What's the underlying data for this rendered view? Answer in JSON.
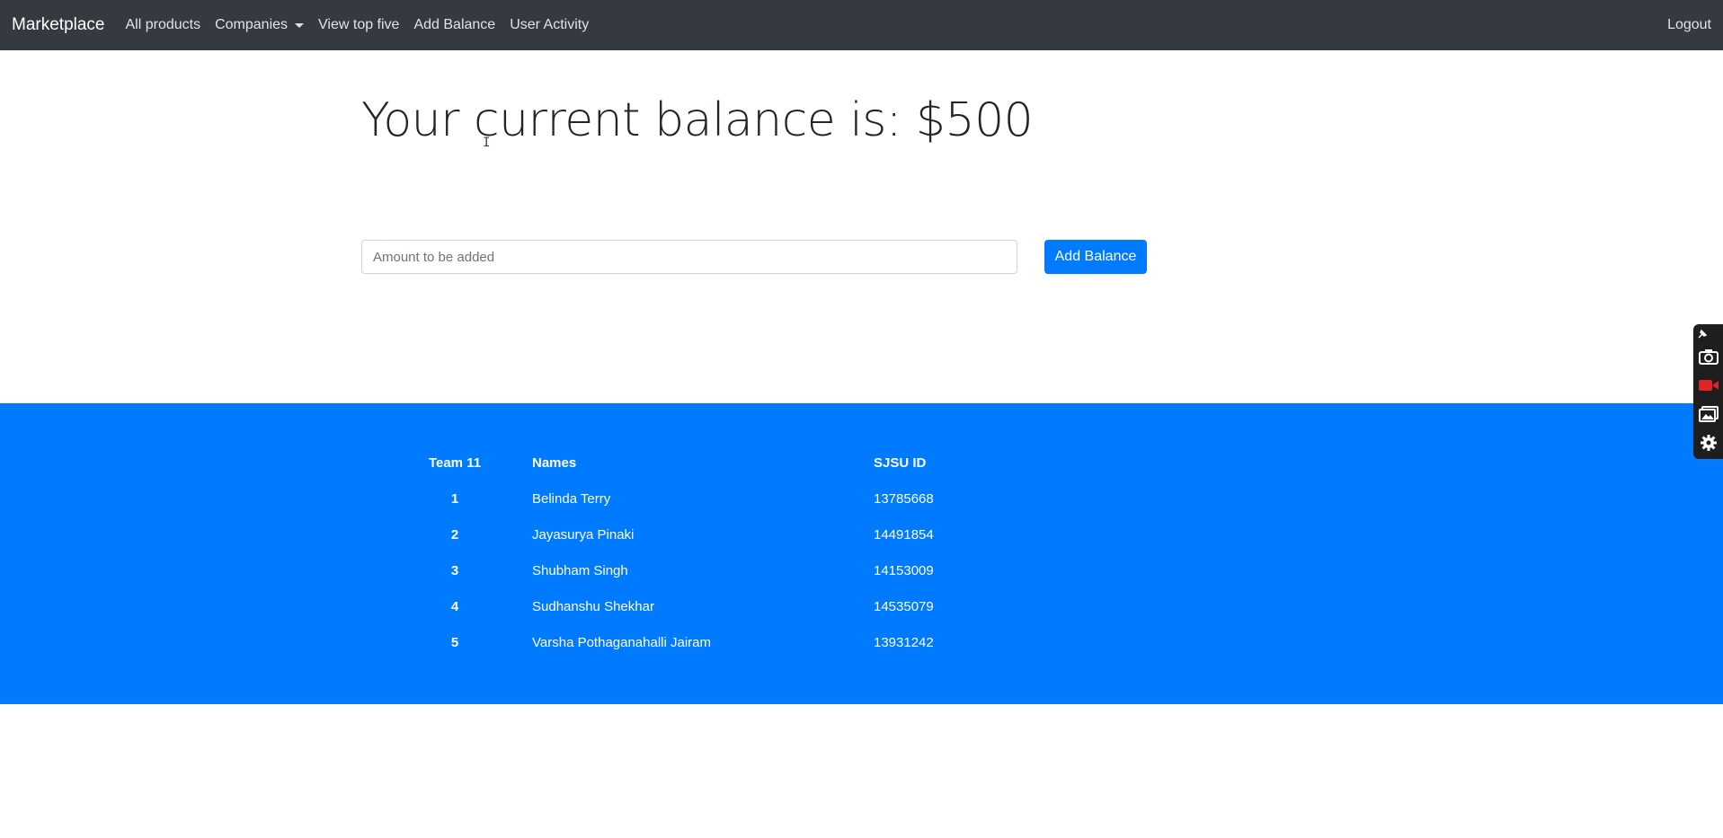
{
  "navbar": {
    "brand": "Marketplace",
    "links": [
      "All products",
      "Companies",
      "View top five",
      "Add Balance",
      "User Activity"
    ],
    "logout": "Logout"
  },
  "balance": {
    "title": "Your current balance is: $500"
  },
  "form": {
    "placeholder": "Amount to be added",
    "button_label": "Add Balance"
  },
  "team": {
    "headers": [
      "Team 11",
      "Names",
      "SJSU ID"
    ],
    "rows": [
      {
        "num": "1",
        "name": "Belinda Terry",
        "id": "13785668"
      },
      {
        "num": "2",
        "name": "Jayasurya Pinaki",
        "id": "14491854"
      },
      {
        "num": "3",
        "name": "Shubham Singh",
        "id": "14153009"
      },
      {
        "num": "4",
        "name": "Sudhanshu Shekhar",
        "id": "14535079"
      },
      {
        "num": "5",
        "name": "Varsha Pothaganahalli Jairam",
        "id": "13931242"
      }
    ]
  },
  "side_widget": {
    "icons": [
      "pin-icon",
      "camera-icon",
      "video-record-icon",
      "gallery-icon",
      "settings-gear-icon"
    ]
  },
  "colors": {
    "navbar_bg": "#343a40",
    "primary": "#007bff",
    "record_red": "#e0242a"
  }
}
